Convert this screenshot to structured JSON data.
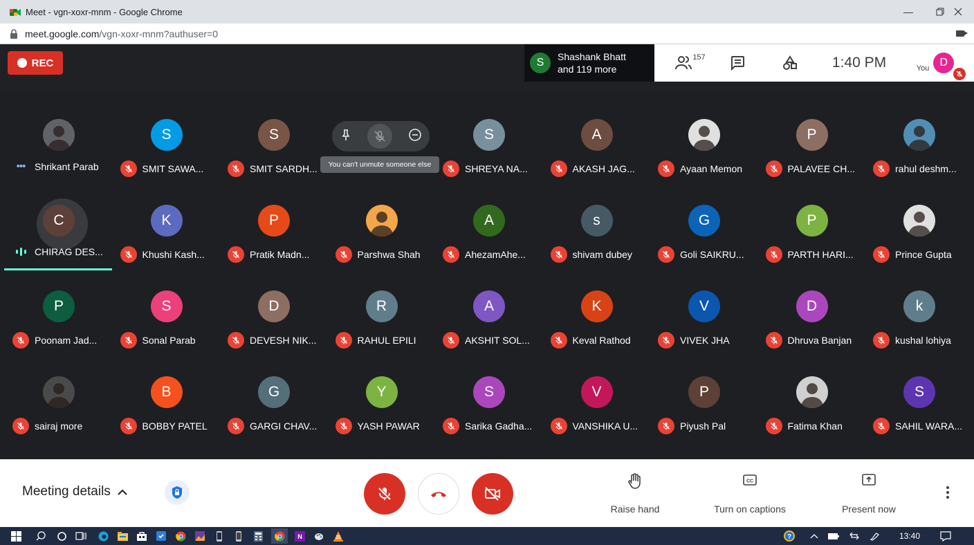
{
  "window": {
    "title": "Meet - vgn-xoxr-mnm - Google Chrome",
    "url_host": "meet.google.com",
    "url_path": "/vgn-xoxr-mnm?authuser=0"
  },
  "top": {
    "rec_label": "REC",
    "speaker_initial": "S",
    "speaker_line1": "Shashank Bhatt",
    "speaker_line2": "and 119 more",
    "people_count": "157",
    "time": "1:40 PM",
    "you_label": "You",
    "self_initial": "D"
  },
  "hover": {
    "tooltip": "You can't unmute someone else"
  },
  "participants": [
    {
      "name": "Shrikant Parab",
      "initial": "",
      "color": "#5f6368",
      "photo": true,
      "state": "dots"
    },
    {
      "name": "SMIT SAWA...",
      "initial": "S",
      "color": "#039be5",
      "photo": false,
      "state": "muted"
    },
    {
      "name": "SMIT SARDH...",
      "initial": "S",
      "color": "#795548",
      "photo": false,
      "state": "muted"
    },
    {
      "name": "",
      "initial": "",
      "color": "#1e1f22",
      "photo": false,
      "state": "hover"
    },
    {
      "name": "SHREYA NA...",
      "initial": "S",
      "color": "#78909c",
      "photo": false,
      "state": "muted"
    },
    {
      "name": "AKASH JAG...",
      "initial": "A",
      "color": "#6d4c41",
      "photo": false,
      "state": "muted"
    },
    {
      "name": "Ayaan Memon",
      "initial": "",
      "color": "#e0e0e0",
      "photo": true,
      "state": "muted"
    },
    {
      "name": "PALAVEE CH...",
      "initial": "P",
      "color": "#8d6e63",
      "photo": false,
      "state": "muted"
    },
    {
      "name": "rahul deshm...",
      "initial": "",
      "color": "#4f8fb5",
      "photo": true,
      "state": "muted"
    },
    {
      "name": "CHIRAG DES...",
      "initial": "C",
      "color": "#5d4037",
      "photo": false,
      "state": "speaking"
    },
    {
      "name": "Khushi Kash...",
      "initial": "K",
      "color": "#5c6bc0",
      "photo": false,
      "state": "muted"
    },
    {
      "name": "Pratik Madn...",
      "initial": "P",
      "color": "#e64a19",
      "photo": false,
      "state": "muted"
    },
    {
      "name": "Parshwa Shah",
      "initial": "",
      "color": "#f4a64a",
      "photo": true,
      "state": "muted"
    },
    {
      "name": "AhezamAhe...",
      "initial": "A",
      "color": "#33691e",
      "photo": false,
      "state": "muted"
    },
    {
      "name": "shivam dubey",
      "initial": "s",
      "color": "#455a64",
      "photo": false,
      "state": "muted"
    },
    {
      "name": "Goli SAIKRU...",
      "initial": "G",
      "color": "#0b64b8",
      "photo": false,
      "state": "muted"
    },
    {
      "name": "PARTH HARI...",
      "initial": "P",
      "color": "#7cb342",
      "photo": false,
      "state": "muted"
    },
    {
      "name": "Prince Gupta",
      "initial": "",
      "color": "#e0e0e0",
      "photo": true,
      "state": "muted"
    },
    {
      "name": "Poonam Jad...",
      "initial": "P",
      "color": "#0d5d40",
      "photo": false,
      "state": "muted"
    },
    {
      "name": "Sonal Parab",
      "initial": "S",
      "color": "#ec407a",
      "photo": false,
      "state": "muted"
    },
    {
      "name": "DEVESH NIK...",
      "initial": "D",
      "color": "#8d6e63",
      "photo": false,
      "state": "muted"
    },
    {
      "name": "RAHUL EPILI",
      "initial": "R",
      "color": "#607d8b",
      "photo": false,
      "state": "muted"
    },
    {
      "name": "AKSHIT SOL...",
      "initial": "A",
      "color": "#7e57c2",
      "photo": false,
      "state": "muted"
    },
    {
      "name": "Keval Rathod",
      "initial": "K",
      "color": "#d84315",
      "photo": false,
      "state": "muted"
    },
    {
      "name": "VIVEK JHA",
      "initial": "V",
      "color": "#0b57b0",
      "photo": false,
      "state": "muted"
    },
    {
      "name": "Dhruva Banjan",
      "initial": "D",
      "color": "#ab47bc",
      "photo": false,
      "state": "muted"
    },
    {
      "name": "kushal lohiya",
      "initial": "k",
      "color": "#607d8b",
      "photo": false,
      "state": "muted"
    },
    {
      "name": "sairaj more",
      "initial": "",
      "color": "#4a4a4a",
      "photo": true,
      "state": "muted"
    },
    {
      "name": "BOBBY PATEL",
      "initial": "B",
      "color": "#f4511e",
      "photo": false,
      "state": "muted"
    },
    {
      "name": "GARGI CHAV...",
      "initial": "G",
      "color": "#546e7a",
      "photo": false,
      "state": "muted"
    },
    {
      "name": "YASH PAWAR",
      "initial": "Y",
      "color": "#7cb342",
      "photo": false,
      "state": "muted"
    },
    {
      "name": "Sarika Gadha...",
      "initial": "S",
      "color": "#ab47bc",
      "photo": false,
      "state": "muted"
    },
    {
      "name": "VANSHIKA U...",
      "initial": "V",
      "color": "#c2185b",
      "photo": false,
      "state": "muted"
    },
    {
      "name": "Piyush Pal",
      "initial": "P",
      "color": "#5d4037",
      "photo": false,
      "state": "muted"
    },
    {
      "name": "Fatima Khan",
      "initial": "",
      "color": "#d0d0d0",
      "photo": true,
      "state": "muted"
    },
    {
      "name": "SAHIL WARA...",
      "initial": "S",
      "color": "#5e35b1",
      "photo": false,
      "state": "muted"
    }
  ],
  "controls": {
    "meeting_details": "Meeting details",
    "raise_hand": "Raise hand",
    "captions": "Turn on captions",
    "present": "Present now"
  },
  "taskbar": {
    "time": "13:40"
  },
  "colors": {
    "accent_red": "#d93025",
    "speaking_teal": "#64ffda",
    "background": "#202124"
  }
}
